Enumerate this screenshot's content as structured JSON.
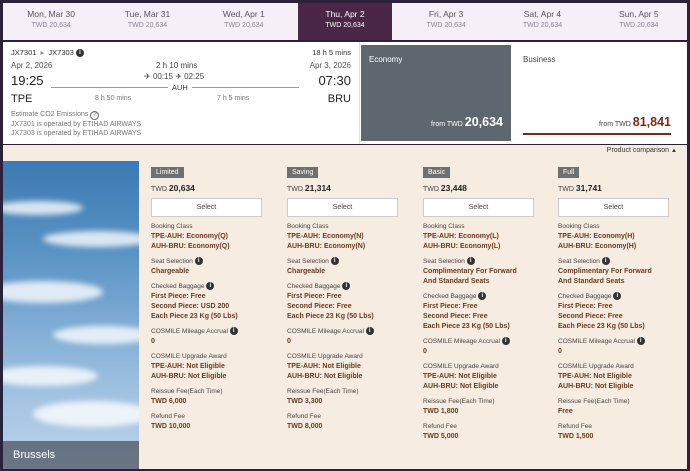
{
  "dates": [
    {
      "day": "Mon, Mar 30",
      "price": "TWD 20,634",
      "selected": false
    },
    {
      "day": "Tue, Mar 31",
      "price": "TWD 20,634",
      "selected": false
    },
    {
      "day": "Wed, Apr 1",
      "price": "TWD 20,634",
      "selected": false
    },
    {
      "day": "Thu, Apr 2",
      "price": "TWD 20,634",
      "selected": true
    },
    {
      "day": "Fri, Apr 3",
      "price": "TWD 20,634",
      "selected": false
    },
    {
      "day": "Sat, Apr 4",
      "price": "TWD 20,634",
      "selected": false
    },
    {
      "day": "Sun, Apr 5",
      "price": "TWD 20,634",
      "selected": false
    }
  ],
  "flight": {
    "flight_a": "JX7301",
    "arrow": "▸",
    "flight_b": "JX7303",
    "total_duration": "18 h 5 mins",
    "dep_date": "Apr 2, 2026",
    "arr_date": "Apr 3, 2026",
    "dep_time": "19:25",
    "arr_time": "07:30",
    "dep_airport": "TPE",
    "arr_airport": "BRU",
    "layover_duration": "2 h 10 mins",
    "layover_arrive": "00:15",
    "layover_depart": "02:25",
    "layover_airport": "AUH",
    "leg1_duration": "8 h 50 mins",
    "leg2_duration": "7 h 5 mins",
    "co2": "Estimate CO2 Emissions",
    "operated1": "JX7301 is operated by ETIHAD AIRWAYS",
    "operated2": "JX7303 is operated by ETIHAD AIRWAYS"
  },
  "cabins": {
    "economy": {
      "label": "Economy",
      "from": "from TWD",
      "price": "20,634"
    },
    "business": {
      "label": "Business",
      "from": "from TWD",
      "price": "81,841"
    }
  },
  "panel": {
    "product_comparison": "Product comparison",
    "city": "Brussels"
  },
  "fare_columns": [
    {
      "tag": "Limited",
      "currency": "TWD",
      "price": "20,634",
      "select": "Select",
      "booking_label": "Booking Class",
      "booking1": "TPE-AUH: Economy(Q)",
      "booking2": "AUH-BRU: Economy(Q)",
      "seat_label": "Seat Selection",
      "seat1": "Chargeable",
      "seat2": "",
      "bag_label": "Checked Baggage",
      "bag1": "First Piece: Free",
      "bag2": "Second Piece: USD 200",
      "bag3": "Each Piece 23 Kg (50 Lbs)",
      "mileage_label": "COSMILE Mileage Accrual",
      "mileage": "0",
      "upgrade_label": "COSMILE Upgrade Award",
      "upgrade1": "TPE-AUH: Not Eligible",
      "upgrade2": "AUH-BRU: Not Eligible",
      "reissue_label": "Reissue Fee(Each Time)",
      "reissue": "TWD 6,000",
      "refund_label": "Refund Fee",
      "refund": "TWD 10,000"
    },
    {
      "tag": "Saving",
      "currency": "TWD",
      "price": "21,314",
      "select": "Select",
      "booking_label": "Booking Class",
      "booking1": "TPE-AUH: Economy(N)",
      "booking2": "AUH-BRU: Economy(N)",
      "seat_label": "Seat Selection",
      "seat1": "Chargeable",
      "seat2": "",
      "bag_label": "Checked Baggage",
      "bag1": "First Piece: Free",
      "bag2": "Second Piece: Free",
      "bag3": "Each Piece 23 Kg (50 Lbs)",
      "mileage_label": "COSMILE Mileage Accrual",
      "mileage": "0",
      "upgrade_label": "COSMILE Upgrade Award",
      "upgrade1": "TPE-AUH: Not Eligible",
      "upgrade2": "AUH-BRU: Not Eligible",
      "reissue_label": "Reissue Fee(Each Time)",
      "reissue": "TWD 3,300",
      "refund_label": "Refund Fee",
      "refund": "TWD 8,000"
    },
    {
      "tag": "Basic",
      "currency": "TWD",
      "price": "23,448",
      "select": "Select",
      "booking_label": "Booking Class",
      "booking1": "TPE-AUH: Economy(L)",
      "booking2": "AUH-BRU: Economy(L)",
      "seat_label": "Seat Selection",
      "seat1": "Complimentary For Forward",
      "seat2": "And Standard Seats",
      "bag_label": "Checked Baggage",
      "bag1": "First Piece: Free",
      "bag2": "Second Piece: Free",
      "bag3": "Each Piece 23 Kg (50 Lbs)",
      "mileage_label": "COSMILE Mileage Accrual",
      "mileage": "0",
      "upgrade_label": "COSMILE Upgrade Award",
      "upgrade1": "TPE-AUH: Not Eligible",
      "upgrade2": "AUH-BRU: Not Eligible",
      "reissue_label": "Reissue Fee(Each Time)",
      "reissue": "TWD 1,800",
      "refund_label": "Refund Fee",
      "refund": "TWD 5,000"
    },
    {
      "tag": "Full",
      "currency": "TWD",
      "price": "31,741",
      "select": "Select",
      "booking_label": "Booking Class",
      "booking1": "TPE-AUH: Economy(H)",
      "booking2": "AUH-BRU: Economy(H)",
      "seat_label": "Seat Selection",
      "seat1": "Complimentary For Forward",
      "seat2": "And Standard Seats",
      "bag_label": "Checked Baggage",
      "bag1": "First Piece: Free",
      "bag2": "Second Piece: Free",
      "bag3": "Each Piece 23 Kg (50 Lbs)",
      "mileage_label": "COSMILE Mileage Accrual",
      "mileage": "0",
      "upgrade_label": "COSMILE Upgrade Award",
      "upgrade1": "TPE-AUH: Not Eligible",
      "upgrade2": "AUH-BRU: Not Eligible",
      "reissue_label": "Reissue Fee(Each Time)",
      "reissue": "Free",
      "refund_label": "Refund Fee",
      "refund": "TWD 1,500"
    }
  ]
}
